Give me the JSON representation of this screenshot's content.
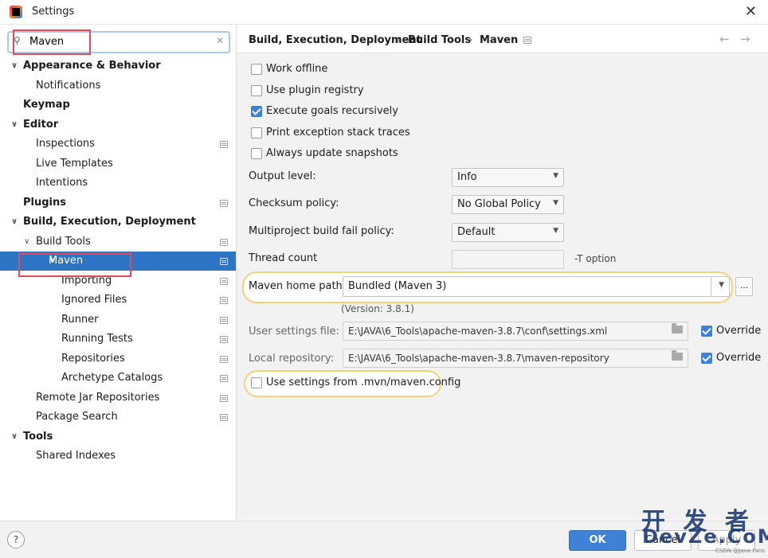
{
  "window": {
    "title": "Settings"
  },
  "search": {
    "value": "Maven"
  },
  "tree": [
    {
      "label": "Appearance & Behavior",
      "expanded": true,
      "bold": true
    },
    {
      "label": "Notifications"
    },
    {
      "label": "Keymap",
      "bold": true
    },
    {
      "label": "Editor",
      "expanded": true,
      "bold": true
    },
    {
      "label": "Inspections"
    },
    {
      "label": "Live Templates"
    },
    {
      "label": "Intentions"
    },
    {
      "label": "Plugins",
      "bold": true
    },
    {
      "label": "Build, Execution, Deployment",
      "expanded": true,
      "bold": true
    },
    {
      "label": "Build Tools",
      "expanded": true
    },
    {
      "label": "Maven",
      "expanded": true,
      "selected": true
    },
    {
      "label": "Importing"
    },
    {
      "label": "Ignored Files"
    },
    {
      "label": "Runner"
    },
    {
      "label": "Running Tests"
    },
    {
      "label": "Repositories"
    },
    {
      "label": "Archetype Catalogs"
    },
    {
      "label": "Remote Jar Repositories"
    },
    {
      "label": "Package Search"
    },
    {
      "label": "Tools",
      "expanded": true,
      "bold": true
    },
    {
      "label": "Shared Indexes"
    }
  ],
  "breadcrumb": [
    "Build, Execution, Deployment",
    "Build Tools",
    "Maven"
  ],
  "checkboxes": [
    {
      "label": "Work offline",
      "checked": false
    },
    {
      "label": "Use plugin registry",
      "checked": false
    },
    {
      "label": "Execute goals recursively",
      "checked": true
    },
    {
      "label": "Print exception stack traces",
      "checked": false
    },
    {
      "label": "Always update snapshots",
      "checked": false
    }
  ],
  "fields": {
    "output_level": {
      "label": "Output level:",
      "value": "Info"
    },
    "checksum_policy": {
      "label": "Checksum policy:",
      "value": "No Global Policy"
    },
    "fail_policy": {
      "label": "Multiproject build fail policy:",
      "value": "Default"
    },
    "thread_count": {
      "label": "Thread count",
      "value": "",
      "suffix": "-T option"
    },
    "maven_home": {
      "label": "Maven home path:",
      "value": "Bundled (Maven 3)",
      "browse": "...",
      "version": "(Version: 3.8.1)"
    },
    "user_settings": {
      "label": "User settings file:",
      "value": "E:\\JAVA\\6_Tools\\apache-maven-3.8.7\\conf\\settings.xml",
      "override_label": "Override",
      "override": true
    },
    "local_repo": {
      "label": "Local repository:",
      "value": "E:\\JAVA\\6_Tools\\apache-maven-3.8.7\\maven-repository",
      "override_label": "Override",
      "override": true
    },
    "mvn_config": {
      "label": "Use settings from .mvn/maven.config",
      "checked": false
    }
  },
  "footer": {
    "help": "?",
    "ok": "OK",
    "cancel": "Cancel",
    "apply": "Apply"
  },
  "watermark": {
    "line1": "开 发 者",
    "line2": "DevZe.CoM",
    "line3": "CSDN @Java Fans"
  },
  "colors": {
    "selection": "#2e74c4",
    "accent": "#3d82d6",
    "annotation": "#e24b5a",
    "highlight": "#f2d27a"
  }
}
